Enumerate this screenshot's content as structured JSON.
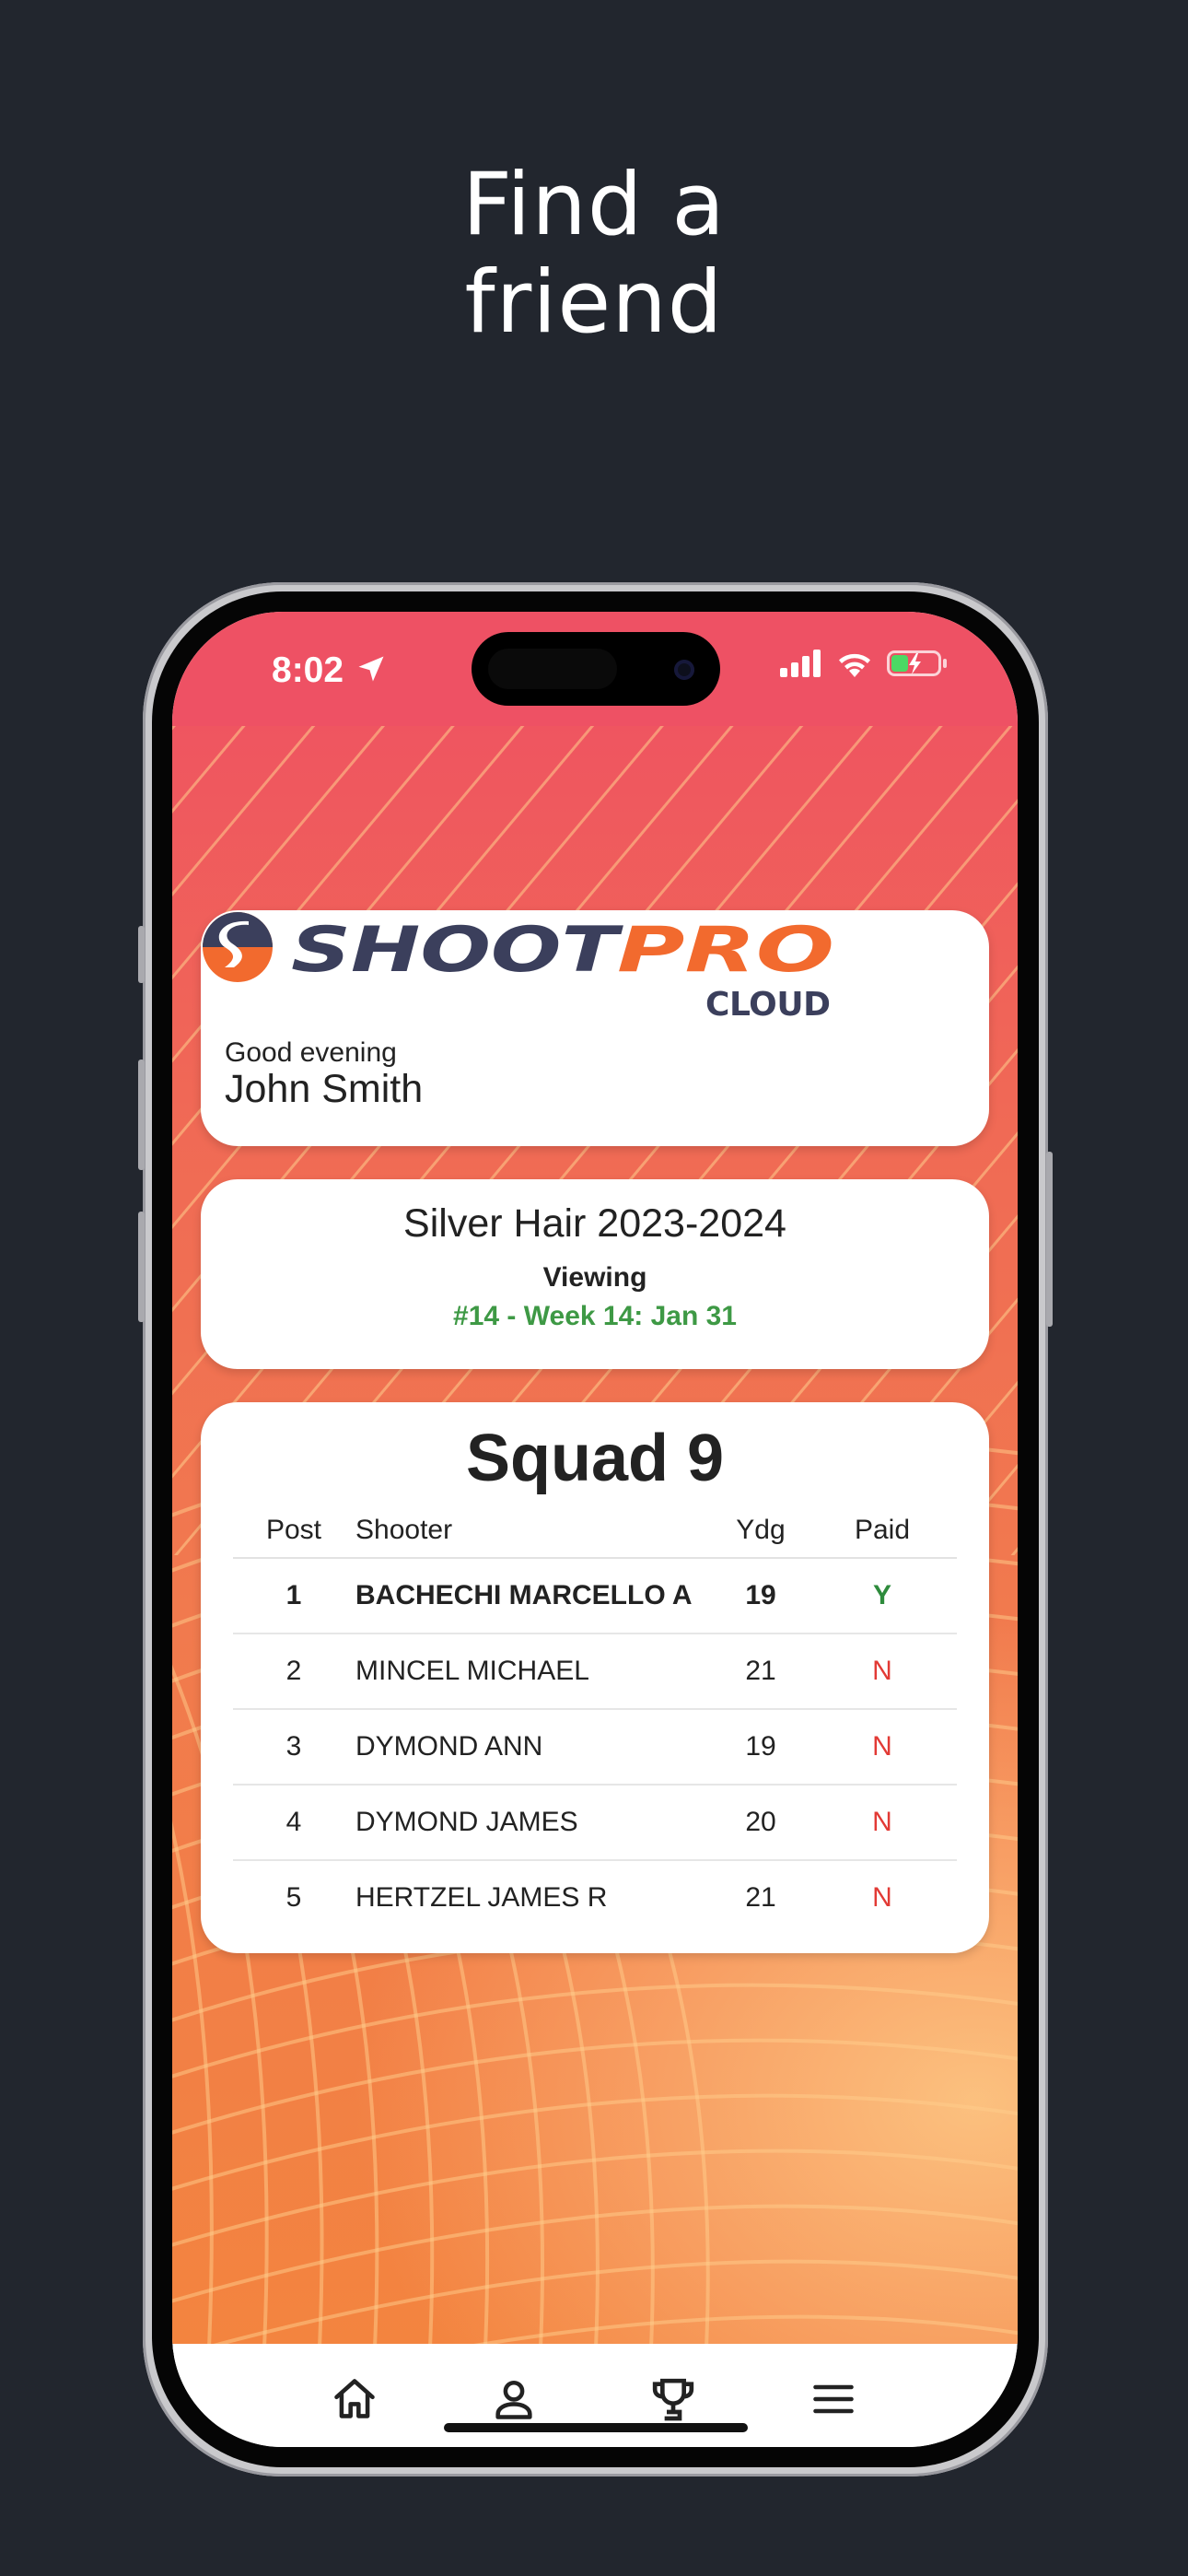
{
  "headline": {
    "line1": "Find a",
    "line2": "friend"
  },
  "status_bar": {
    "time": "8:02",
    "icons": [
      "location-arrow-icon",
      "cellular-signal-icon",
      "wifi-icon",
      "battery-charging-icon"
    ]
  },
  "header_card": {
    "logo_word_left": "SHOOT",
    "logo_word_right": "PRO",
    "logo_sub": "CLOUD",
    "greeting": "Good evening",
    "user_name": "John Smith"
  },
  "season_card": {
    "title": "Silver Hair 2023-2024",
    "viewing_label": "Viewing",
    "week": "#14 - Week 14: Jan 31"
  },
  "squad_card": {
    "title": "Squad 9",
    "columns": {
      "post": "Post",
      "shooter": "Shooter",
      "ydg": "Ydg",
      "paid": "Paid"
    },
    "rows": [
      {
        "post": "1",
        "shooter": "BACHECHI MARCELLO A",
        "ydg": "19",
        "paid": "Y"
      },
      {
        "post": "2",
        "shooter": "MINCEL MICHAEL",
        "ydg": "21",
        "paid": "N"
      },
      {
        "post": "3",
        "shooter": "DYMOND ANN",
        "ydg": "19",
        "paid": "N"
      },
      {
        "post": "4",
        "shooter": "DYMOND JAMES",
        "ydg": "20",
        "paid": "N"
      },
      {
        "post": "5",
        "shooter": "HERTZEL JAMES R",
        "ydg": "21",
        "paid": "N"
      }
    ]
  },
  "tab_bar": {
    "tabs": [
      "home-icon",
      "profile-icon",
      "trophy-icon",
      "menu-icon"
    ]
  },
  "colors": {
    "page_bg": "#22262e",
    "status_bar": "#ee5164",
    "accent_orange": "#f26a2e",
    "logo_navy": "#3b3f5c",
    "week_green": "#3e9945",
    "paid_yes": "#2e8b3c",
    "paid_no": "#e23a35"
  }
}
